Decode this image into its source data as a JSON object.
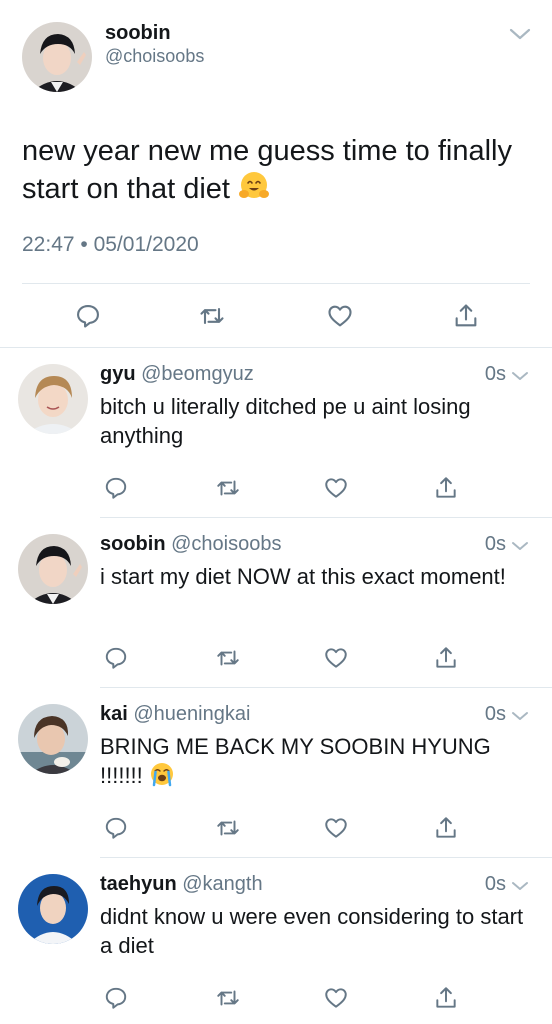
{
  "main_tweet": {
    "name": "soobin",
    "handle": "@choisoobs",
    "text": "new year new me guess time to finally start on that diet",
    "emoji": "hugging-face",
    "time": "22:47 • 05/01/2020"
  },
  "replies": [
    {
      "name": "gyu",
      "handle": "@beomgyuz",
      "time": "0s",
      "text": "bitch u literally ditched pe u aint losing anything",
      "emoji": ""
    },
    {
      "name": "soobin",
      "handle": "@choisoobs",
      "time": "0s",
      "text": "i start my diet NOW at this exact moment!",
      "emoji": ""
    },
    {
      "name": "kai",
      "handle": "@hueningkai",
      "time": "0s",
      "text": "BRING ME BACK MY SOOBIN HYUNG !!!!!!!",
      "emoji": "loudly-crying-face"
    },
    {
      "name": "taehyun",
      "handle": "@kangth",
      "time": "0s",
      "text": "didnt know u were even considering to start a diet",
      "emoji": ""
    }
  ],
  "icons": {
    "reply": "reply-icon",
    "retweet": "retweet-icon",
    "like": "heart-icon",
    "share": "share-icon",
    "more": "chevron-down-icon"
  },
  "colors": {
    "icon": "#657786",
    "text": "#14171a",
    "secondary": "#657786",
    "divider": "#e1e8ed"
  }
}
